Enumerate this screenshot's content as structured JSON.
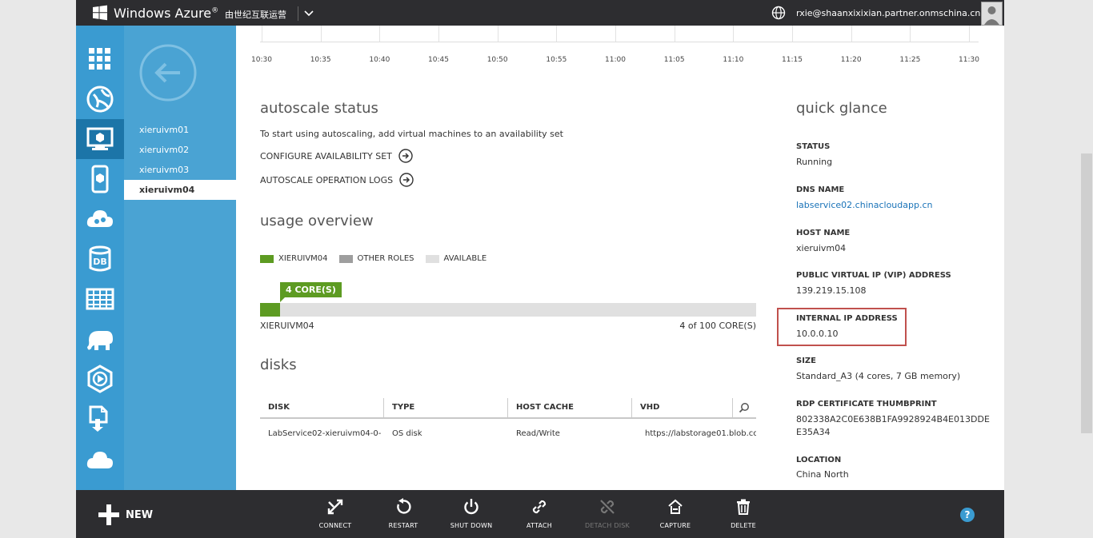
{
  "header": {
    "brand": "Windows Azure",
    "brand_mark": "®",
    "operator": "由世纪互联运营",
    "account": "rxie@shaanxixixian.partner.onmschina.cn"
  },
  "sidebar": {
    "icons": [
      "all-items-icon",
      "web-sites-icon",
      "virtual-machines-icon",
      "mobile-services-icon",
      "cloud-services-icon",
      "sql-databases-icon",
      "storage-icon",
      "hdinsight-icon",
      "media-services-icon",
      "service-bus-icon",
      "active-directory-icon"
    ],
    "db_label": "DB"
  },
  "vm_list": [
    {
      "label": "xieruivm01"
    },
    {
      "label": "xieruivm02"
    },
    {
      "label": "xieruivm03"
    },
    {
      "label": "xieruivm04"
    }
  ],
  "chart": {
    "ticks": [
      "10:30",
      "10:35",
      "10:40",
      "10:45",
      "10:50",
      "10:55",
      "11:00",
      "11:05",
      "11:10",
      "11:15",
      "11:20",
      "11:25",
      "11:30"
    ]
  },
  "autoscale": {
    "title": "autoscale status",
    "description": "To start using autoscaling, add virtual machines to an availability set",
    "configure_link": "CONFIGURE AVAILABILITY SET",
    "logs_link": "AUTOSCALE OPERATION LOGS"
  },
  "usage": {
    "title": "usage overview",
    "legend": {
      "vm": "XIERUIVM04",
      "other": "OTHER ROLES",
      "available": "AVAILABLE"
    },
    "colors": {
      "vm": "#5d9b22",
      "other": "#9e9e9e",
      "available": "#e0e0e0"
    },
    "badge": "4 CORE(S)",
    "vm_name": "XIERUIVM04",
    "used_cores": "4",
    "of_text": " of 100 CORE(S)",
    "used_fraction": 0.04
  },
  "disks": {
    "title": "disks",
    "columns": [
      "DISK",
      "TYPE",
      "HOST CACHE",
      "VHD"
    ],
    "rows": [
      {
        "disk": "LabService02-xieruivm04-0-",
        "type": "OS disk",
        "host_cache": "Read/Write",
        "vhd": "https://labstorage01.blob.co"
      }
    ]
  },
  "quick_glance": {
    "title": "quick glance",
    "status_label": "STATUS",
    "status_value": "Running",
    "dns_label": "DNS NAME",
    "dns_value": "labservice02.chinacloudapp.cn",
    "host_label": "HOST NAME",
    "host_value": "xieruivm04",
    "vip_label": "PUBLIC VIRTUAL IP (VIP) ADDRESS",
    "vip_value": "139.219.15.108",
    "internal_label": "INTERNAL IP ADDRESS",
    "internal_value": "10.0.0.10",
    "size_label": "SIZE",
    "size_value": "Standard_A3 (4 cores, 7 GB memory)",
    "rdp_label": "RDP CERTIFICATE THUMBPRINT",
    "rdp_value_1": "802338A2C0E638B1FA9928924B4E013DDE",
    "rdp_value_2": "E35A34",
    "location_label": "LOCATION",
    "location_value": "China North"
  },
  "commands": {
    "new": "NEW",
    "connect": "CONNECT",
    "restart": "RESTART",
    "shutdown": "SHUT DOWN",
    "attach": "ATTACH",
    "detach": "DETACH DISK",
    "capture": "CAPTURE",
    "delete": "DELETE",
    "help": "?"
  }
}
